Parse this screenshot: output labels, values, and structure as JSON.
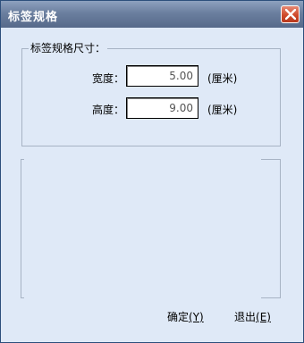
{
  "window": {
    "title": "标签规格"
  },
  "group": {
    "legend": "标签规格尺寸："
  },
  "width_field": {
    "label": "宽度：",
    "value": "5.00",
    "unit": "(厘米)"
  },
  "height_field": {
    "label": "高度：",
    "value": "9.00",
    "unit": "(厘米)"
  },
  "actions": {
    "ok": {
      "label": "确定",
      "hotkey": "(Y)"
    },
    "exit": {
      "label": "退出",
      "hotkey": "(E)"
    }
  },
  "icons": {
    "close": "close-icon"
  },
  "colors": {
    "dialog_bg": "#dfe9f7",
    "titlebar": "#6b7f9f",
    "close": "#cf4a2b"
  }
}
